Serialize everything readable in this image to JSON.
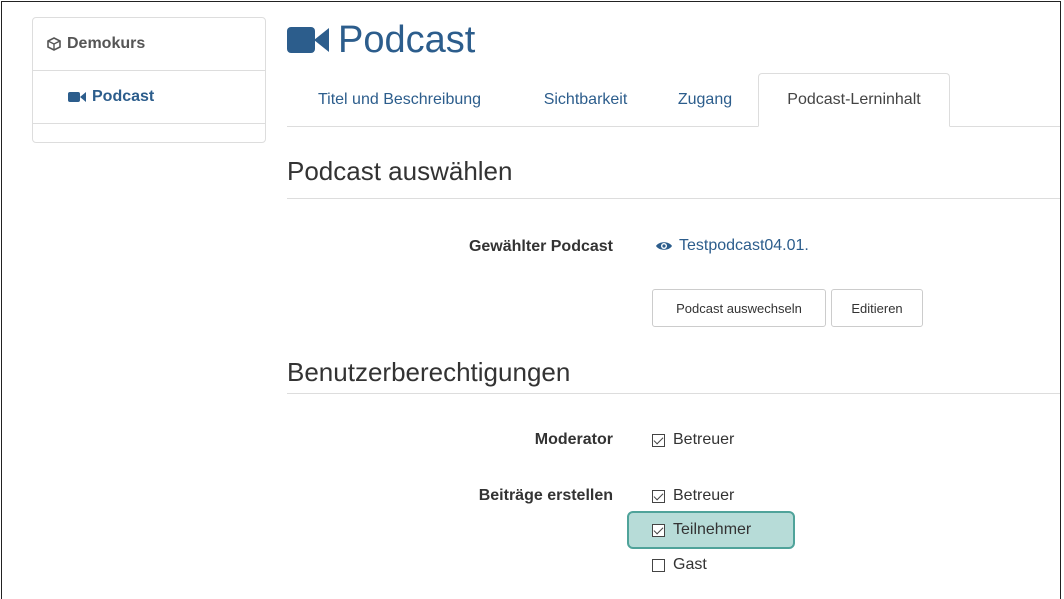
{
  "sidebar": {
    "course": {
      "label": "Demokurs",
      "icon": "cube-icon"
    },
    "node": {
      "label": "Podcast",
      "icon": "video-camera-icon"
    }
  },
  "header": {
    "title": "Podcast",
    "icon": "video-camera-icon"
  },
  "tabs": [
    {
      "label": "Titel und Beschreibung",
      "active": false
    },
    {
      "label": "Sichtbarkeit",
      "active": false
    },
    {
      "label": "Zugang",
      "active": false
    },
    {
      "label": "Podcast-Lerninhalt",
      "active": true
    }
  ],
  "podcast_section": {
    "title": "Podcast auswählen",
    "selected_label": "Gewählter Podcast",
    "selected_value": "Testpodcast04.01.",
    "selected_icon": "eye-icon",
    "replace_button": "Podcast auswechseln",
    "edit_button": "Editieren"
  },
  "permissions_section": {
    "title": "Benutzerberechtigungen",
    "moderator_label": "Moderator",
    "moderator_options": [
      {
        "label": "Betreuer",
        "checked": true
      }
    ],
    "posts_label": "Beiträge erstellen",
    "posts_options": [
      {
        "label": "Betreuer",
        "checked": true
      },
      {
        "label": "Teilnehmer",
        "checked": true,
        "highlighted": true
      },
      {
        "label": "Gast",
        "checked": false
      }
    ]
  },
  "colors": {
    "link": "#2c5d8c",
    "highlight_bg": "#b7dcd8",
    "highlight_border": "#4fa39a"
  }
}
